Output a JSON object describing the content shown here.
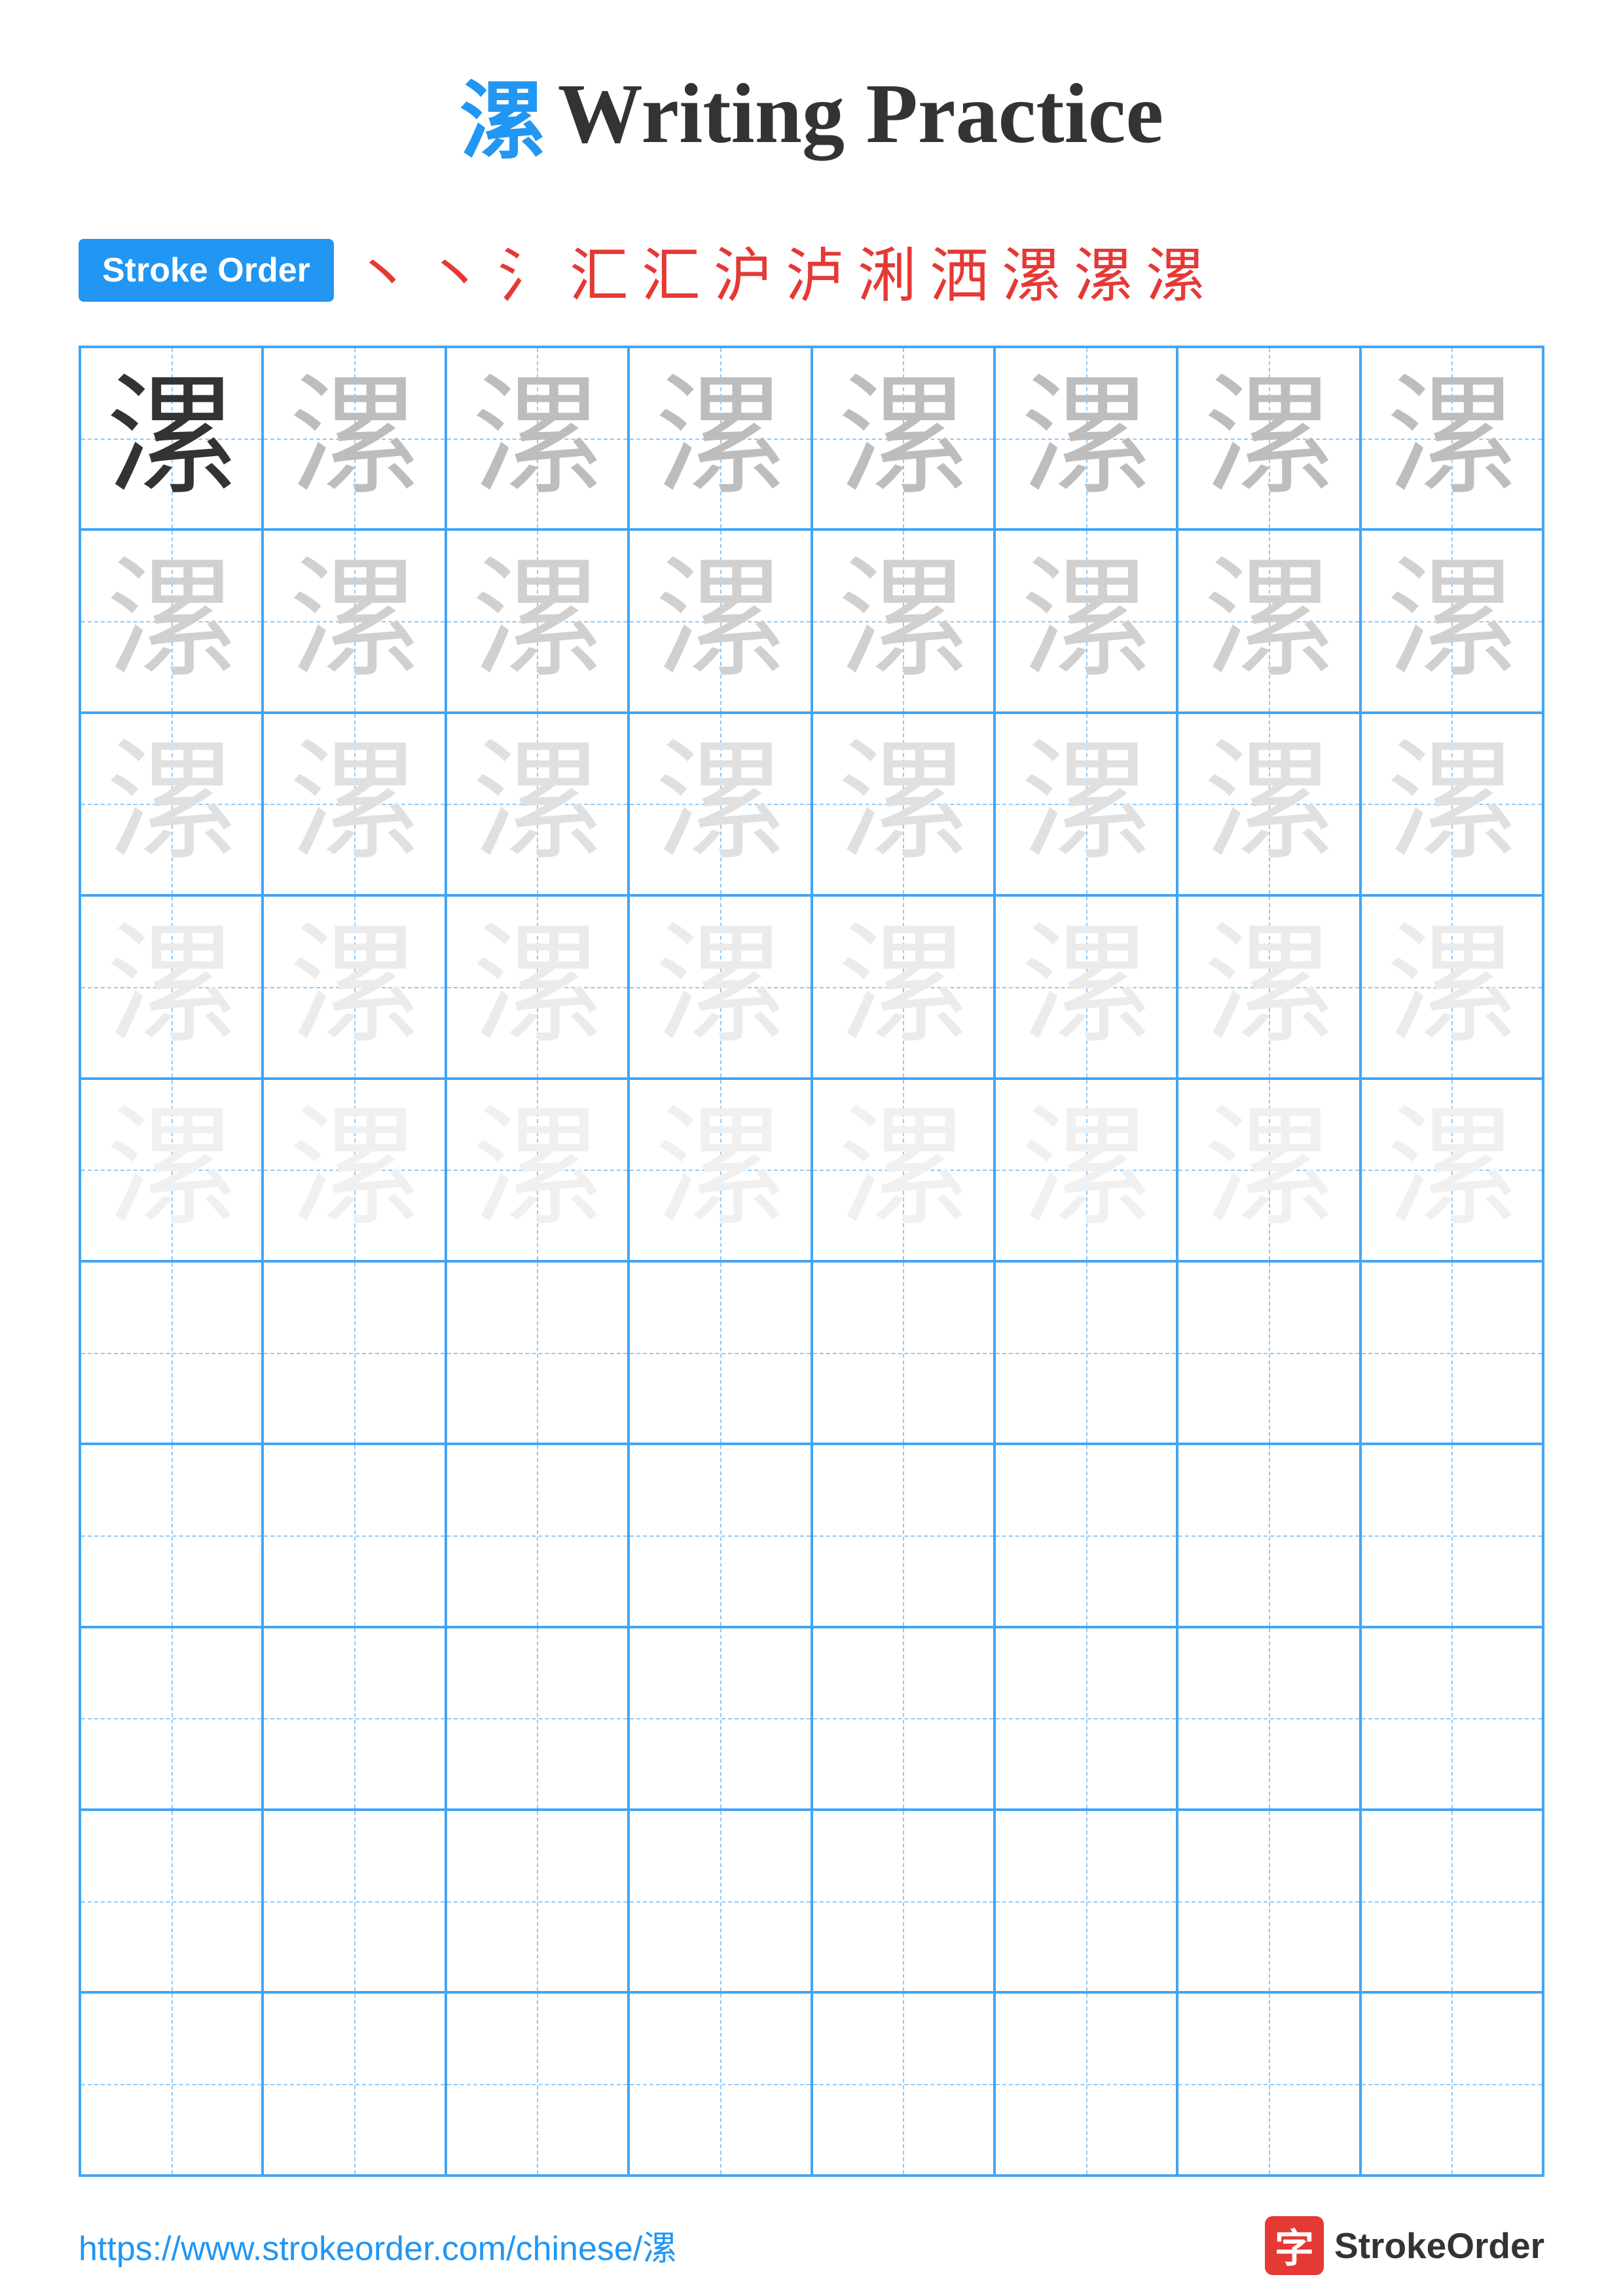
{
  "title": {
    "char": "漯",
    "text": "Writing Practice",
    "char_color": "#2196F3"
  },
  "stroke_order": {
    "badge_label": "Stroke Order",
    "strokes": [
      "丶",
      "丶",
      "氵",
      "汇",
      "汇",
      "沪",
      "泸",
      "洃",
      "洒",
      "漯",
      "漯",
      "漯"
    ]
  },
  "grid": {
    "rows": 10,
    "cols": 8,
    "char": "漯",
    "filled_rows": 5,
    "opacity_levels": [
      "dark",
      "light1",
      "light2",
      "light3",
      "light4"
    ]
  },
  "footer": {
    "url": "https://www.strokeorder.com/chinese/漯",
    "logo_char": "字",
    "logo_text": "StrokeOrder"
  }
}
